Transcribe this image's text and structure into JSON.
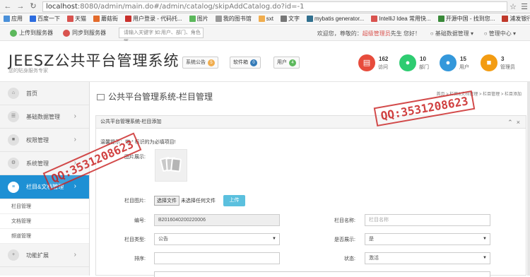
{
  "browser": {
    "url_host": "localhost",
    "url_rest": ":8080/admin/main.do#/admin/catalog/skipAddCatalog.do?id=-1",
    "bookmarks": [
      "应用",
      "百度一下",
      "天猫",
      "蘑菇街",
      "用户登录 - 代码托...",
      "图片",
      "我的图书馆",
      "sxt",
      "文字",
      "mybatis generator...",
      "IntelliJ Idea 常用快...",
      "开源中国 - 找到您...",
      "浦发银行"
    ]
  },
  "topbar": {
    "upload_label": "上传到服务器",
    "sync_label": "同步到服务器",
    "search_placeholder": "请输入关键字 如:用户、部门、角色等",
    "welcome_prefix": "欢迎您，尊敬的：",
    "role": "超级管理员",
    "welcome_suffix": "先生 您好！",
    "basic_data": "基础数据管理",
    "admin_center": "管理中心"
  },
  "header": {
    "logo": "JEESZ公共平台管理系统",
    "slogan": "您的贴身服务专家",
    "buttons": [
      {
        "label": "系统公告",
        "badge": "5",
        "color": "#f0ad4e"
      },
      {
        "label": "软件箱",
        "badge": "0",
        "color": "#337ab7"
      },
      {
        "label": "用户",
        "badge": "4",
        "color": "#5cb85c"
      }
    ],
    "stats": [
      {
        "num": "162",
        "label": "访问",
        "color": "#e74c3c",
        "icon": "chart-icon"
      },
      {
        "num": "10",
        "label": "部门",
        "color": "#2ecc71",
        "icon": "money-icon"
      },
      {
        "num": "15",
        "label": "用户",
        "color": "#3498db",
        "icon": "user-icon"
      },
      {
        "num": "3",
        "label": "管理员",
        "color": "#f39c12",
        "icon": "gift-icon"
      }
    ]
  },
  "sidebar": {
    "items": [
      {
        "label": "首页",
        "icon": "home-icon"
      },
      {
        "label": "基础数据管理",
        "icon": "database-icon"
      },
      {
        "label": "权限管理",
        "icon": "lock-icon"
      },
      {
        "label": "系统管理",
        "icon": "cog-icon"
      },
      {
        "label": "栏目&文档管理",
        "icon": "list-icon"
      }
    ],
    "subitems": [
      "栏目管理",
      "文档管理",
      "频道管理"
    ],
    "extra": {
      "label": "功能扩展",
      "icon": "plus-icon"
    }
  },
  "main": {
    "title": "公共平台管理系统-栏目管理",
    "breadcrumb": "首页 > 栏目&文档管理 > 栏目管理 > 栏目添加",
    "panel_title": "公共平台管理系统-栏目添加",
    "tip": "温馨提示：带 * 标识的为必填项目!",
    "image_label": "图片展示:",
    "upload_label": "栏目图片:",
    "file_button": "选择文件",
    "file_status": "未选择任何文件",
    "upload_btn": "上传",
    "fields": {
      "code_label": "编号:",
      "code_value": "B2016040200220006",
      "name_label": "栏目名称:",
      "name_placeholder": "栏目名称",
      "type_label": "栏目类型:",
      "type_value": "公告",
      "display_label": "是否展示:",
      "display_value": "是",
      "sort_label": "排序:",
      "status_label": "状态:",
      "status_value": "激活"
    }
  },
  "watermark": "QQ:3531208623"
}
